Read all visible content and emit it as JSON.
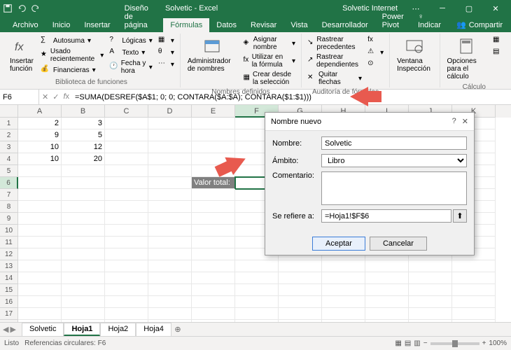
{
  "titlebar": {
    "title": "Solvetic - Excel",
    "user": "Solvetic Internet"
  },
  "tabs": {
    "archivo": "Archivo",
    "inicio": "Inicio",
    "insertar": "Insertar",
    "diseno": "Diseño de página",
    "formulas": "Fórmulas",
    "datos": "Datos",
    "revisar": "Revisar",
    "vista": "Vista",
    "desarrollador": "Desarrollador",
    "powerpivot": "Power Pivot",
    "indicar": "Indicar",
    "compartir": "Compartir"
  },
  "ribbon": {
    "insertar_funcion": "Insertar función",
    "autosuma": "Autosuma",
    "usado_reciente": "Usado recientemente",
    "financieras": "Financieras",
    "logicas": "Lógicas",
    "texto": "Texto",
    "fecha_hora": "Fecha y hora",
    "biblioteca": "Biblioteca de funciones",
    "admin_nombres": "Administrador de nombres",
    "asignar_nombre": "Asignar nombre",
    "utilizar_formula": "Utilizar en la fórmula",
    "crear_seleccion": "Crear desde la selección",
    "nombres_def": "Nombres definidos",
    "rastrear_prec": "Rastrear precedentes",
    "rastrear_dep": "Rastrear dependientes",
    "quitar_flechas": "Quitar flechas",
    "auditoria": "Auditoría de fórmulas",
    "ventana_insp": "Ventana Inspección",
    "opciones_calc": "Opciones para el cálculo",
    "calculo": "Cálculo"
  },
  "formula_bar": {
    "namebox": "F6",
    "formula": "=SUMA(DESREF($A$1; 0; 0; CONTARA($A:$A); CONTARA($1:$1)))"
  },
  "columns": [
    "A",
    "B",
    "C",
    "D",
    "E",
    "F",
    "G",
    "H",
    "I",
    "J",
    "K"
  ],
  "rows_count": 18,
  "cells": {
    "A1": "2",
    "B1": "3",
    "A2": "9",
    "B2": "5",
    "A3": "10",
    "B3": "12",
    "A4": "10",
    "B4": "20",
    "E6": "Valor total:"
  },
  "active_cell": "F6",
  "sheets": {
    "items": [
      "Solvetic",
      "Hoja1",
      "Hoja2",
      "Hoja4"
    ],
    "active": "Hoja1"
  },
  "statusbar": {
    "ready": "Listo",
    "circular": "Referencias circulares: F6",
    "zoom": "100%"
  },
  "dialog": {
    "title": "Nombre nuevo",
    "label_nombre": "Nombre:",
    "value_nombre": "Solvetic",
    "label_ambito": "Ámbito:",
    "value_ambito": "Libro",
    "label_comentario": "Comentario:",
    "label_refiere": "Se refiere a:",
    "value_refiere": "=Hoja1!$F$6",
    "btn_ok": "Aceptar",
    "btn_cancel": "Cancelar"
  }
}
